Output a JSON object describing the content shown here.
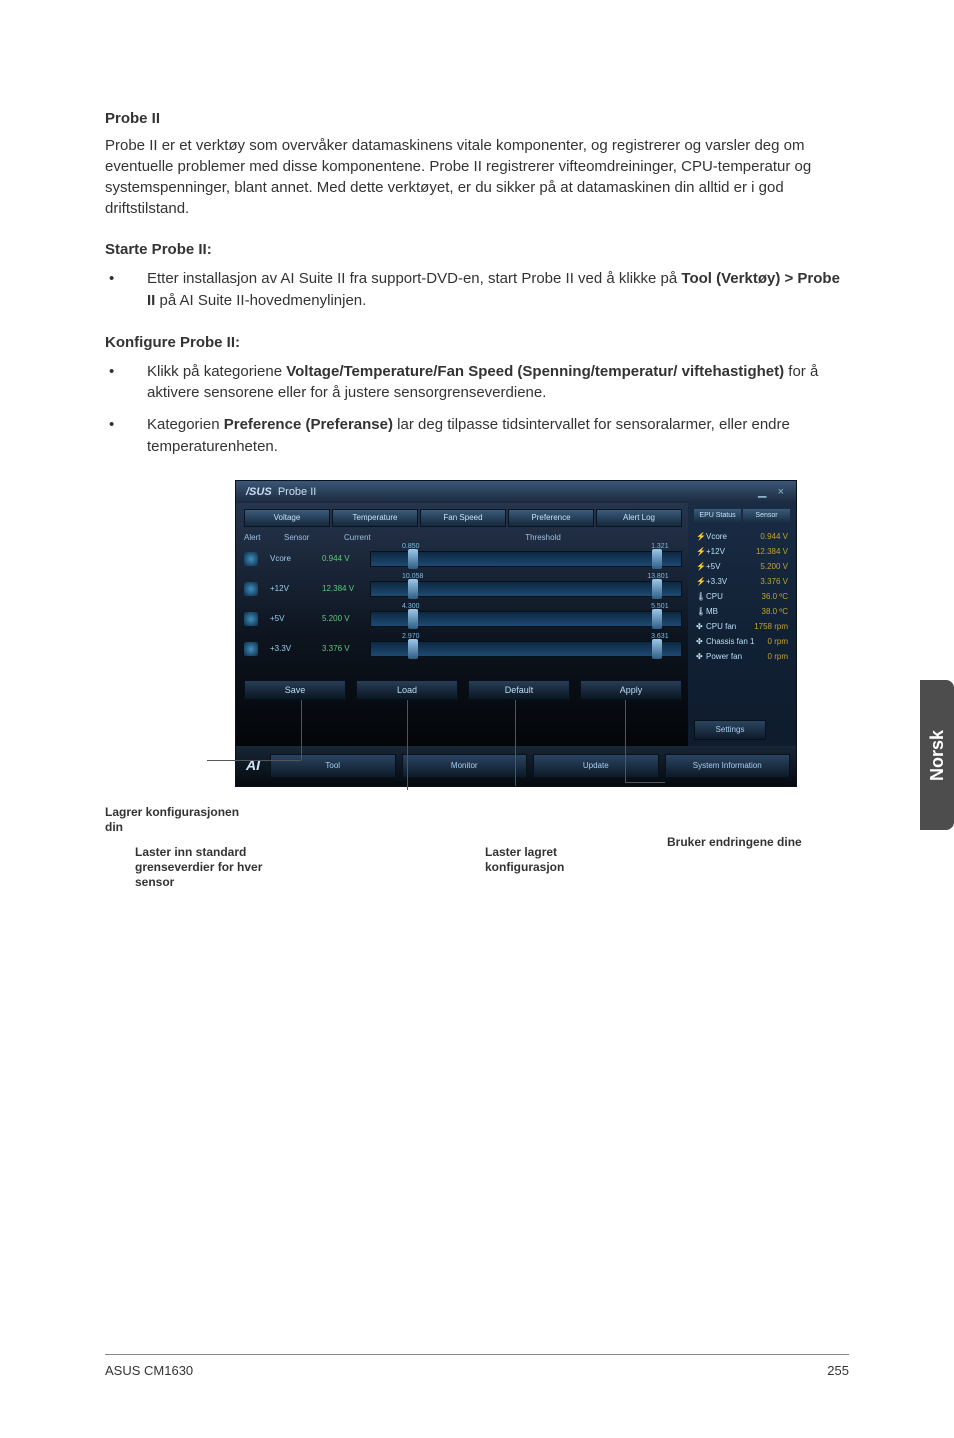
{
  "doc": {
    "h1": "Probe II",
    "p1": "Probe II er et verktøy som overvåker datamaskinens vitale komponenter, og registrerer og varsler deg om eventuelle problemer med disse komponentene. Probe II registrerer vifteomdreininger, CPU-temperatur og systemspenninger, blant annet. Med dette verktøyet, er du sikker på at datamaskinen din alltid er i god driftstilstand.",
    "h2": "Starte Probe II:",
    "b1a": "Etter installasjon av AI Suite II fra support-DVD-en, start Probe II ved å klikke på ",
    "b1b": "Tool (Verktøy) > Probe II",
    "b1c": " på AI Suite II-hovedmenylinjen.",
    "h3": "Konfigure Probe II:",
    "b2a": "Klikk på kategoriene ",
    "b2b": "Voltage/Temperature/Fan Speed (Spenning/temperatur/ viftehastighet)",
    "b2c": " for å aktivere sensorene eller for å justere sensorgrenseverdiene.",
    "b3a": "Kategorien ",
    "b3b": "Preference (Preferanse)",
    "b3c": " lar deg tilpasse tidsintervallet for sensoralarmer, eller endre temperaturenheten."
  },
  "shot": {
    "title_brand": "/SUS",
    "title_app": "Probe II",
    "tabs": [
      "Voltage",
      "Temperature",
      "Fan Speed",
      "Preference",
      "Alert Log"
    ],
    "head": [
      "Alert",
      "Sensor",
      "Current",
      "Threshold"
    ],
    "rows": [
      {
        "name": "Vcore",
        "val": "0.944 V",
        "lo": "0.850",
        "hi": "1.321"
      },
      {
        "name": "+12V",
        "val": "12.384 V",
        "lo": "10.058",
        "hi": "13.801"
      },
      {
        "name": "+5V",
        "val": "5.200 V",
        "lo": "4.300",
        "hi": "5.501"
      },
      {
        "name": "+3.3V",
        "val": "3.376 V",
        "lo": "2.970",
        "hi": "3.631"
      }
    ],
    "btns": {
      "save": "Save",
      "load": "Load",
      "default": "Default",
      "apply": "Apply"
    },
    "bottom": {
      "tool": "Tool",
      "monitor": "Monitor",
      "update": "Update",
      "sysinfo": "System Information",
      "settings": "Settings"
    },
    "right": {
      "hdr1": "EPU Status",
      "hdr2": "Sensor",
      "items": [
        {
          "ic": "⚡",
          "nm": "Vcore",
          "vl": "0.944 V"
        },
        {
          "ic": "⚡",
          "nm": "+12V",
          "vl": "12.384 V"
        },
        {
          "ic": "⚡",
          "nm": "+5V",
          "vl": "5.200 V"
        },
        {
          "ic": "⚡",
          "nm": "+3.3V",
          "vl": "3.376 V"
        },
        {
          "ic": "🌡",
          "nm": "CPU",
          "vl": "36.0 ºC"
        },
        {
          "ic": "🌡",
          "nm": "MB",
          "vl": "38.0 ºC"
        },
        {
          "ic": "✤",
          "nm": "CPU fan",
          "vl": "1758 rpm"
        },
        {
          "ic": "✤",
          "nm": "Chassis fan 1",
          "vl": "0 rpm"
        },
        {
          "ic": "✤",
          "nm": "Power fan",
          "vl": "0 rpm"
        }
      ]
    }
  },
  "callouts": {
    "c1": "Lagrer konfigurasjonen din",
    "c2": "Laster inn standard grenseverdier for hver sensor",
    "c3": "Laster lagret konfigurasjon",
    "c4a": "Bruker en",
    "c4b": "dringene dine"
  },
  "sidetab": "Norsk",
  "footer": {
    "left": "ASUS CM1630",
    "right": "255"
  }
}
